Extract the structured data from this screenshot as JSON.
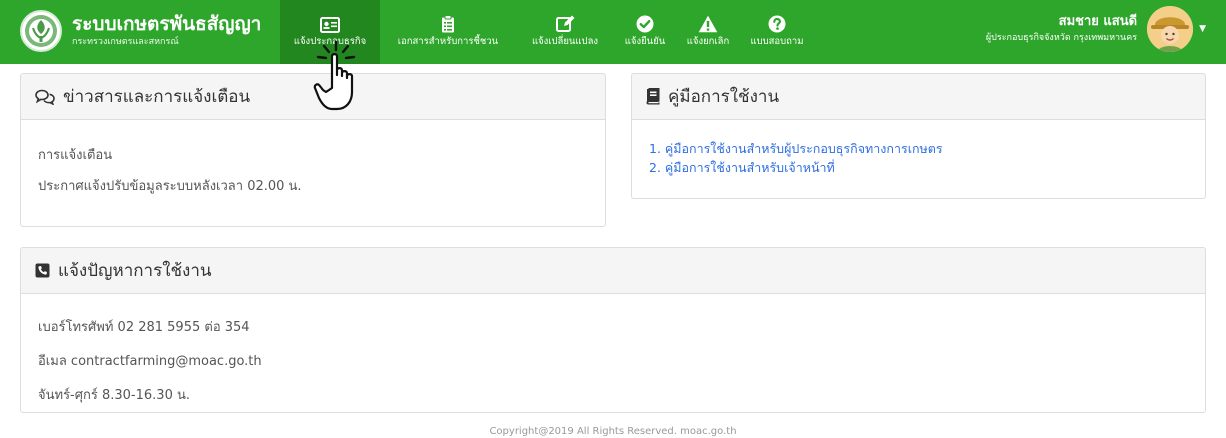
{
  "app": {
    "title": "ระบบเกษตรพันธสัญญา",
    "subtitle": "กระทรวงเกษตรและสหกรณ์"
  },
  "nav": {
    "items": [
      {
        "label": "แจ้งประกอบธุรกิจ",
        "icon": "id-card-icon"
      },
      {
        "label": "เอกสารสำหรับการชี้ชวน",
        "icon": "clipboard-list-icon"
      },
      {
        "label": "แจ้งเปลี่ยนแปลง",
        "icon": "edit-icon"
      },
      {
        "label": "แจ้งยืนยัน",
        "icon": "check-circle-icon"
      },
      {
        "label": "แจ้งยกเลิก",
        "icon": "warning-icon"
      },
      {
        "label": "แบบสอบถาม",
        "icon": "question-circle-icon"
      }
    ]
  },
  "user": {
    "name": "สมชาย แสนดี",
    "role": "ผู้ประกอบธุรกิจจังหวัด กรุงเทพมหานคร"
  },
  "news": {
    "title": "ข่าวสารและการแจ้งเตือน",
    "icon": "comments-icon",
    "rows": [
      "การแจ้งเตือน",
      "ประกาศแจ้งปรับข้อมูลระบบหลังเวลา 02.00 น."
    ]
  },
  "manual": {
    "title": "คู่มือการใช้งาน",
    "icon": "book-icon",
    "links": [
      "1. คู่มือการใช้งานสำหรับผู้ประกอบธุรกิจทางการเกษตร",
      "2. คู่มือการใช้งานสำหรับเจ้าหน้าที่"
    ]
  },
  "issues": {
    "title": "แจ้งปัญหาการใช้งาน",
    "icon": "phone-square-icon",
    "rows": [
      "เบอร์โทรศัพท์ 02 281 5955 ต่อ 354",
      "อีเมล contractfarming@moac.go.th",
      "จันทร์-ศุกร์ 8.30-16.30 น."
    ]
  },
  "footer": {
    "text": "Copyright@2019 All Rights Reserved. moac.go.th"
  },
  "colors": {
    "navbar": "#2ea62b",
    "nav_active": "#22871f",
    "link": "#2e6fe0",
    "panel_head": "#f5f5f5"
  }
}
